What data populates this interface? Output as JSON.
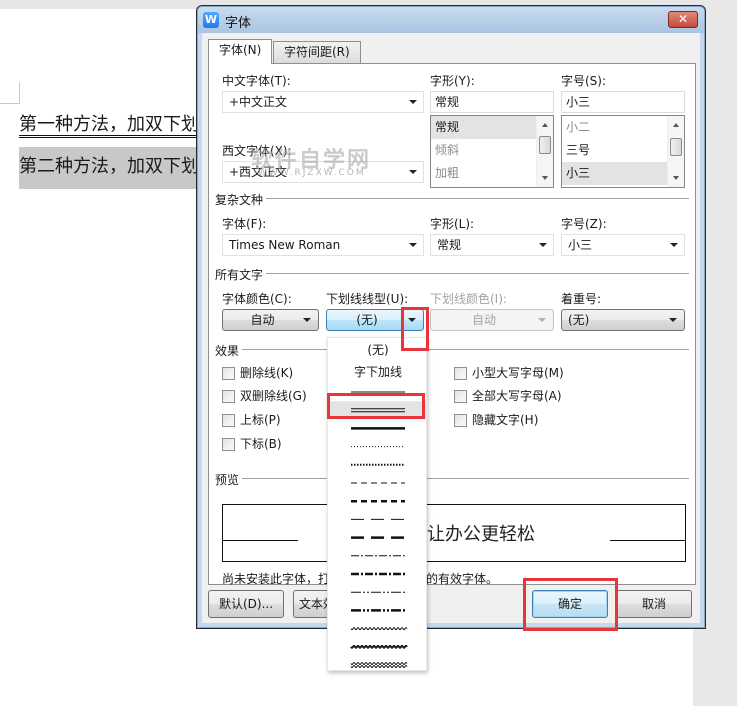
{
  "document": {
    "line1": "第一种方法，加双下划线",
    "line2": "第二种方法，加双下划线"
  },
  "dialog": {
    "title": "字体",
    "app_icon_glyph": "W",
    "close_glyph": "✕",
    "tabs": [
      {
        "label": "字体(N)",
        "active": true
      },
      {
        "label": "字符间距(R)",
        "active": false
      }
    ],
    "chinese_font": {
      "label": "中文字体(T):",
      "value": "+中文正文"
    },
    "western_font": {
      "label": "西文字体(X):",
      "value": "+西文正文"
    },
    "style": {
      "label": "字形(Y):",
      "value": "常规",
      "options": [
        "常规",
        "倾斜",
        "加粗"
      ],
      "selected": "常规"
    },
    "size": {
      "label": "字号(S):",
      "value": "小三",
      "options": [
        "小二",
        "三号",
        "小三"
      ],
      "selected": "小三"
    },
    "complex": {
      "section": "复杂文种",
      "font_label": "字体(F):",
      "font_value": "Times New Roman",
      "style_label": "字形(L):",
      "style_value": "常规",
      "size_label": "字号(Z):",
      "size_value": "小三"
    },
    "all_text": {
      "section": "所有文字",
      "color_label": "字体颜色(C):",
      "color_value": "自动",
      "underline_type_label": "下划线线型(U):",
      "underline_type_value": "(无)",
      "underline_color_label": "下划线颜色(I):",
      "underline_color_value": "自动",
      "emphasis_label": "着重号:",
      "emphasis_value": "(无)"
    },
    "effects": {
      "section": "效果",
      "left": [
        "删除线(K)",
        "双删除线(G)",
        "上标(P)",
        "下标(B)"
      ],
      "right": [
        "小型大写字母(M)",
        "全部大写字母(A)",
        "隐藏文字(H)"
      ]
    },
    "preview": {
      "section": "预览",
      "sample_text": "让办公更轻松",
      "hint": "尚未安装此字体，打印时将采用最相近的有效字体。"
    },
    "buttons": {
      "default": "默认(D)...",
      "text_effects": "文本效果(E)...",
      "ok": "确定",
      "cancel": "取消"
    }
  },
  "underline_dropdown": {
    "items": [
      {
        "label": "(无)",
        "kind": "text"
      },
      {
        "label": "字下加线",
        "kind": "text"
      },
      {
        "label": "single",
        "kind": "line"
      },
      {
        "label": "double",
        "kind": "line",
        "selected": true
      },
      {
        "label": "thick",
        "kind": "line"
      },
      {
        "label": "dotted",
        "kind": "line"
      },
      {
        "label": "dotted-heavy",
        "kind": "line"
      },
      {
        "label": "dashed",
        "kind": "line"
      },
      {
        "label": "dashed-heavy",
        "kind": "line"
      },
      {
        "label": "dash-long",
        "kind": "line"
      },
      {
        "label": "dash-long-heavy",
        "kind": "line"
      },
      {
        "label": "dot-dash",
        "kind": "line"
      },
      {
        "label": "dot-dash-heavy",
        "kind": "line"
      },
      {
        "label": "dot-dot-dash",
        "kind": "line"
      },
      {
        "label": "dot-dot-dash-heavy",
        "kind": "line"
      },
      {
        "label": "wave",
        "kind": "line"
      },
      {
        "label": "wave-heavy",
        "kind": "line"
      },
      {
        "label": "wave-double",
        "kind": "line"
      }
    ]
  },
  "watermark": {
    "text": "软件自学网",
    "sub": "WWW.RJZXW.COM"
  },
  "colors": {
    "highlight": "#e8353a",
    "accent": "#3c7fb1",
    "title_bar": "#b9d1ea"
  }
}
